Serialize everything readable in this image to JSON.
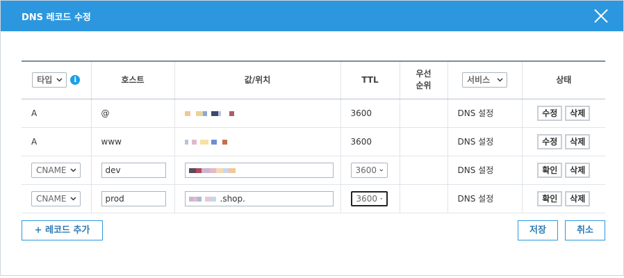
{
  "dialog": {
    "title": "DNS 레코드 수정"
  },
  "table": {
    "headers": {
      "type_select": "타입",
      "info_icon": "i",
      "host": "호스트",
      "value": "값/위치",
      "ttl": "TTL",
      "priority_line1": "우선",
      "priority_line2": "순위",
      "service_select": "서비스",
      "status": "상태"
    },
    "rows": [
      {
        "type": "A",
        "host": "@",
        "ttl": "3600",
        "service": "DNS 설정",
        "btn1": "수정",
        "btn2": "삭제"
      },
      {
        "type": "A",
        "host": "www",
        "ttl": "3600",
        "service": "DNS 설정",
        "btn1": "수정",
        "btn2": "삭제"
      },
      {
        "type": "CNAME",
        "host": "dev",
        "ttl": "3600",
        "service": "DNS 설정",
        "btn1": "확인",
        "btn2": "삭제"
      },
      {
        "type": "CNAME",
        "host": "prod",
        "value_suffix": ".shop.",
        "ttl": "3600",
        "service": "DNS 설정",
        "btn1": "확인",
        "btn2": "삭제"
      }
    ]
  },
  "footer": {
    "add_record": "+ 레코드 추가",
    "save": "저장",
    "cancel": "취소"
  },
  "colors": {
    "accent": "#2c97de",
    "info": "#1aa0e6"
  }
}
